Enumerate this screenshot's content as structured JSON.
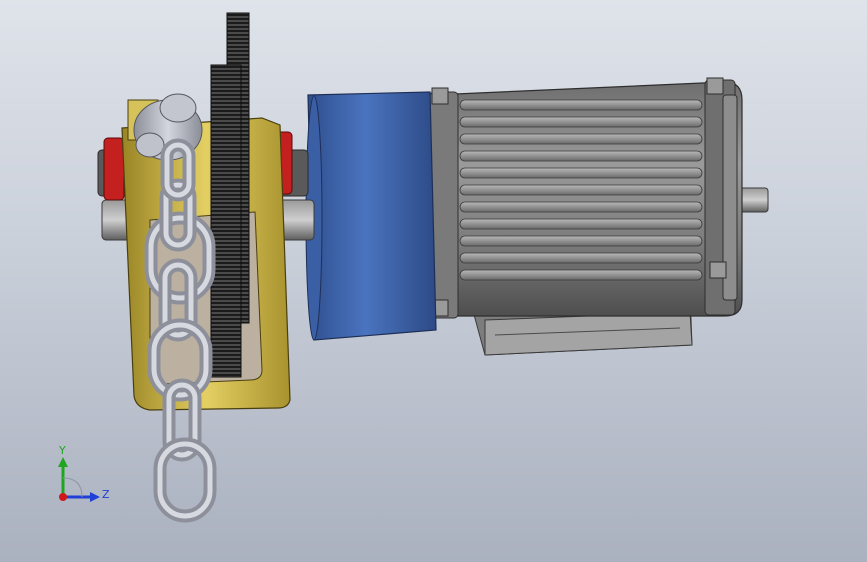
{
  "viewport": {
    "background_top": "#dfe3ea",
    "background_bottom": "#aab1bf"
  },
  "assembly": {
    "components": [
      "motor-housing",
      "gearbox-cover",
      "spur-gear",
      "yellow-frame",
      "chain-sprocket",
      "load-chain",
      "red-bearing-caps",
      "output-shaft",
      "motor-shaft",
      "mounting-base"
    ],
    "colors": {
      "motor": "#8a8a8a",
      "gearbox_cover": "#3f68b3",
      "frame": "#d8c25a",
      "chain": "#b9bcc6",
      "gear": "#2a2a2a",
      "bearing_caps": "#c42020"
    }
  },
  "triad": {
    "y_label": "Y",
    "z_label": "Z",
    "y_color": "#1fa51f",
    "z_color": "#1f3fd6",
    "origin_color": "#d01818"
  }
}
